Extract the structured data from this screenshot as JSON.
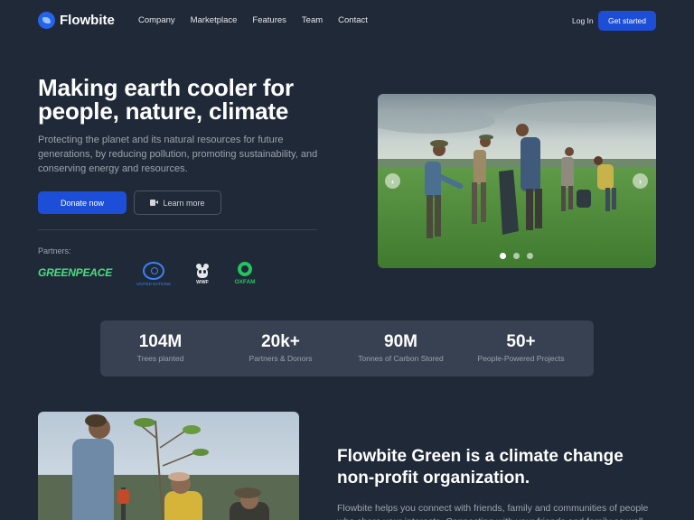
{
  "header": {
    "brand": "Flowbite",
    "menu": [
      "Company",
      "Marketplace",
      "Features",
      "Team",
      "Contact"
    ],
    "login": "Log In",
    "cta": "Get started"
  },
  "hero": {
    "title": "Making earth cooler for people, nature, climate",
    "description": "Protecting the planet and its natural resources for future generations, by reducing pollution, promoting sustainability, and conserving energy and resources.",
    "donate_label": "Donate now",
    "learn_label": "Learn more",
    "partners_label": "Partners:",
    "partners": {
      "greenpeace": "GREENPEACE",
      "un": "UNITED NATIONS",
      "wwf": "WWF",
      "oxfam": "OXFAM"
    }
  },
  "carousel": {
    "prev_icon": "chevron-left-icon",
    "next_icon": "chevron-right-icon",
    "slides": 3,
    "active_slide": 1
  },
  "stats": [
    {
      "value": "104M",
      "label": "Trees planted"
    },
    {
      "value": "20k+",
      "label": "Partners & Donors"
    },
    {
      "value": "90M",
      "label": "Tonnes of Carbon Stored"
    },
    {
      "value": "50+",
      "label": "People-Powered Projects"
    }
  ],
  "feature": {
    "title": "Flowbite Green is a climate change non-profit organization.",
    "description": "Flowbite helps you connect with friends, family and communities of people who share your interests. Connecting with your friends and family as well"
  },
  "colors": {
    "background": "#1f2937",
    "accent": "#1d4ed8",
    "card": "#374151"
  }
}
